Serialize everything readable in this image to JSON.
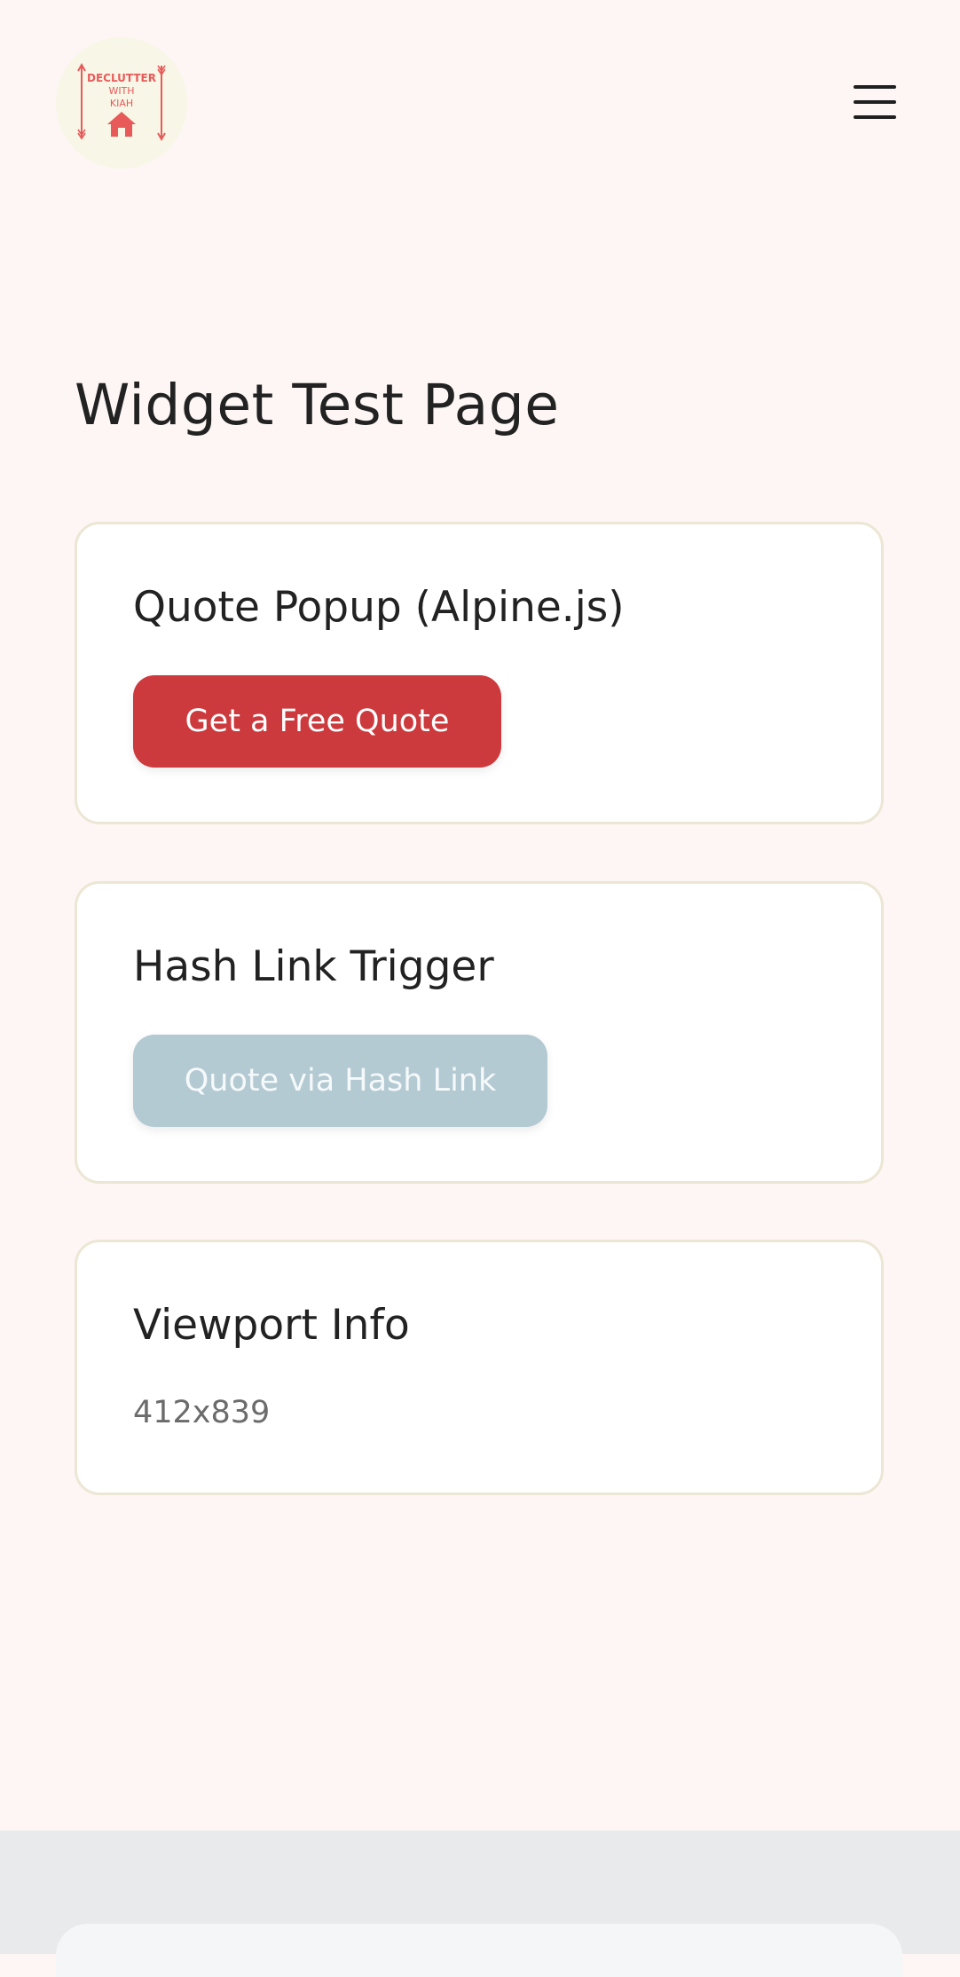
{
  "brand": {
    "logo_line1": "DECLUTTER",
    "logo_line2": "WITH",
    "logo_line3": "KIAH",
    "logo_bg_color": "#f8f6e6",
    "logo_color": "#e85a5a"
  },
  "header": {
    "menu_icon": "hamburger-menu-icon"
  },
  "page": {
    "title": "Widget Test Page"
  },
  "cards": {
    "quote_popup": {
      "title": "Quote Popup (Alpine.js)",
      "button_label": "Get a Free Quote",
      "button_color": "#cc3a3e"
    },
    "hash_link": {
      "title": "Hash Link Trigger",
      "button_label": "Quote via Hash Link",
      "button_color": "#b3cad3"
    },
    "viewport": {
      "title": "Viewport Info",
      "value": "412x839"
    }
  },
  "colors": {
    "page_bg": "#fdf6f5",
    "card_border": "#ece6d4",
    "footer_bg": "#e9eaec"
  }
}
